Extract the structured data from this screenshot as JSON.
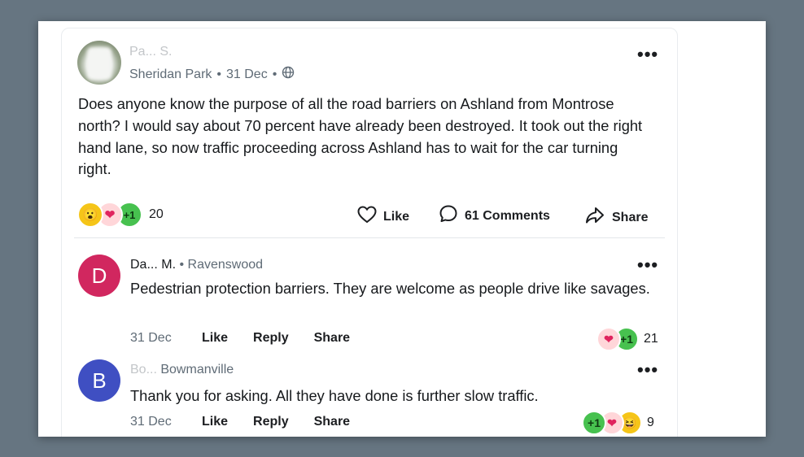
{
  "post": {
    "author": "Pa... S.",
    "location": "Sheridan Park",
    "date": "31 Dec",
    "body": "Does anyone know the purpose of all the road barriers on Ashland from Montrose north?  I would say about 70 percent have already been destroyed.  It took out the right hand lane, so now traffic proceeding across Ashland has to wait for the car turning right.",
    "reaction_count": "20",
    "reactions": [
      "wow",
      "heart",
      "plus-one"
    ],
    "actions": {
      "like": "Like",
      "comments": "61 Comments",
      "share": "Share"
    }
  },
  "comments": [
    {
      "avatar_letter": "D",
      "avatar_color": "#d1275f",
      "name": "Da... M.",
      "location": "Ravenswood",
      "text": "Pedestrian protection barriers. They are welcome as people drive like savages.",
      "date": "31 Dec",
      "like": "Like",
      "reply": "Reply",
      "share": "Share",
      "reactions": [
        "heart",
        "plus-one"
      ],
      "reaction_count": "21"
    },
    {
      "avatar_letter": "B",
      "avatar_color": "#3f4fc2",
      "name": "Bo...",
      "location": "Bowmanville",
      "text": "Thank you for asking. All they have done is further slow traffic.",
      "date": "31 Dec",
      "like": "Like",
      "reply": "Reply",
      "share": "Share",
      "reactions": [
        "plus-one",
        "heart",
        "laugh"
      ],
      "reaction_count": "9"
    }
  ],
  "icons": {
    "more": "more-dots-icon",
    "globe": "globe-icon",
    "like": "heart-outline-icon",
    "comment": "comment-bubble-icon",
    "share": "share-arrow-icon"
  },
  "glyphs": {
    "more": "•••",
    "separator": "•",
    "plus_one": "+1",
    "wow": "😮",
    "heart": "❤",
    "laugh": "😆"
  }
}
